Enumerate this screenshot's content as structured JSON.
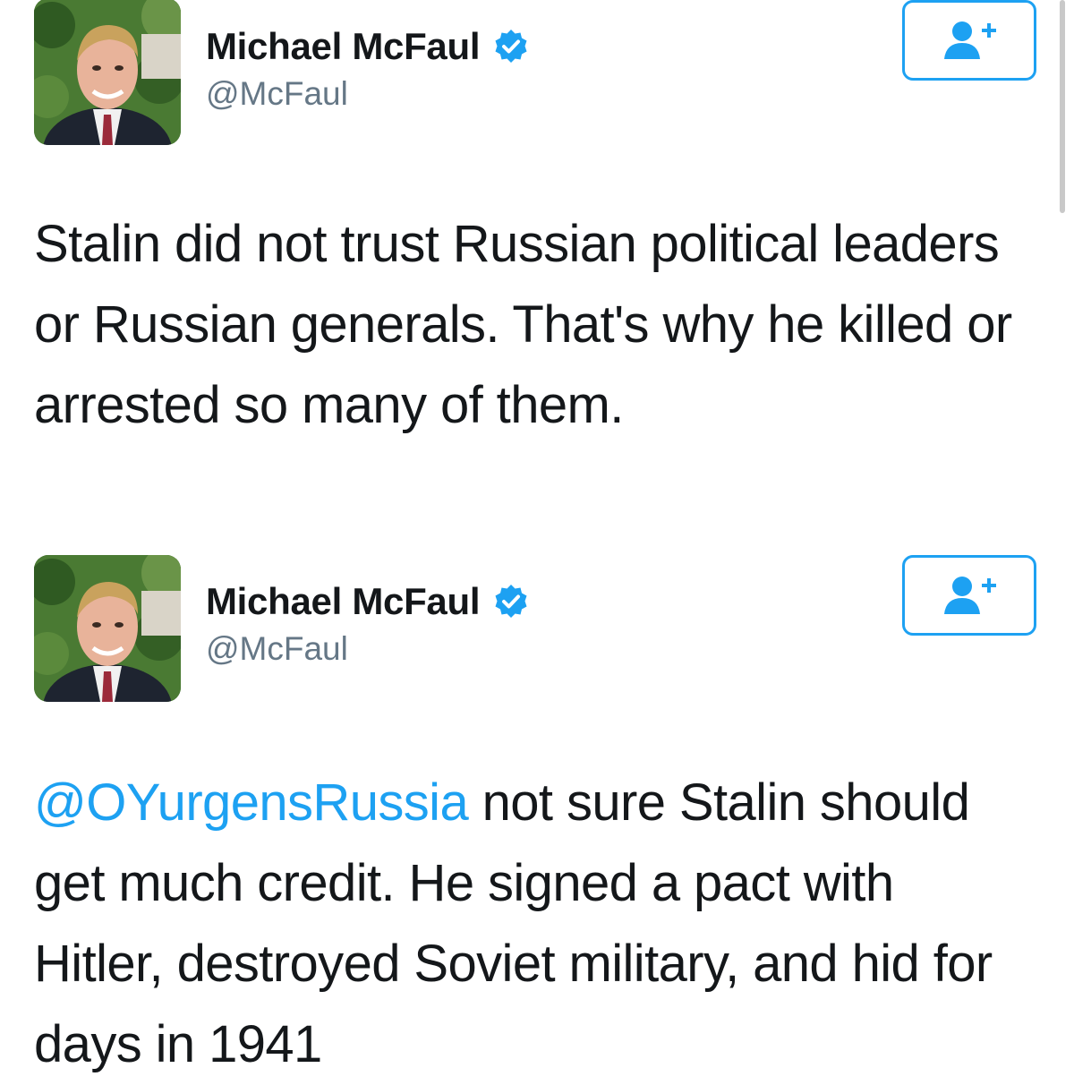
{
  "colors": {
    "accent": "#1da1f2",
    "handle_gray": "#657786",
    "text": "#14171a"
  },
  "tweets": [
    {
      "display_name": "Michael McFaul",
      "handle": "@McFaul",
      "verified_icon": "verified-badge-icon",
      "follow_icon": "add-user-icon",
      "mention": "",
      "text": "Stalin did not trust Russian political leaders or Russian generals.  That's why he killed or arrested so many of them."
    },
    {
      "display_name": "Michael McFaul",
      "handle": "@McFaul",
      "verified_icon": "verified-badge-icon",
      "follow_icon": "add-user-icon",
      "mention": "@OYurgensRussia",
      "text": " not sure Stalin should get much credit. He signed a pact with Hitler, destroyed Soviet military, and hid for days in 1941"
    }
  ]
}
